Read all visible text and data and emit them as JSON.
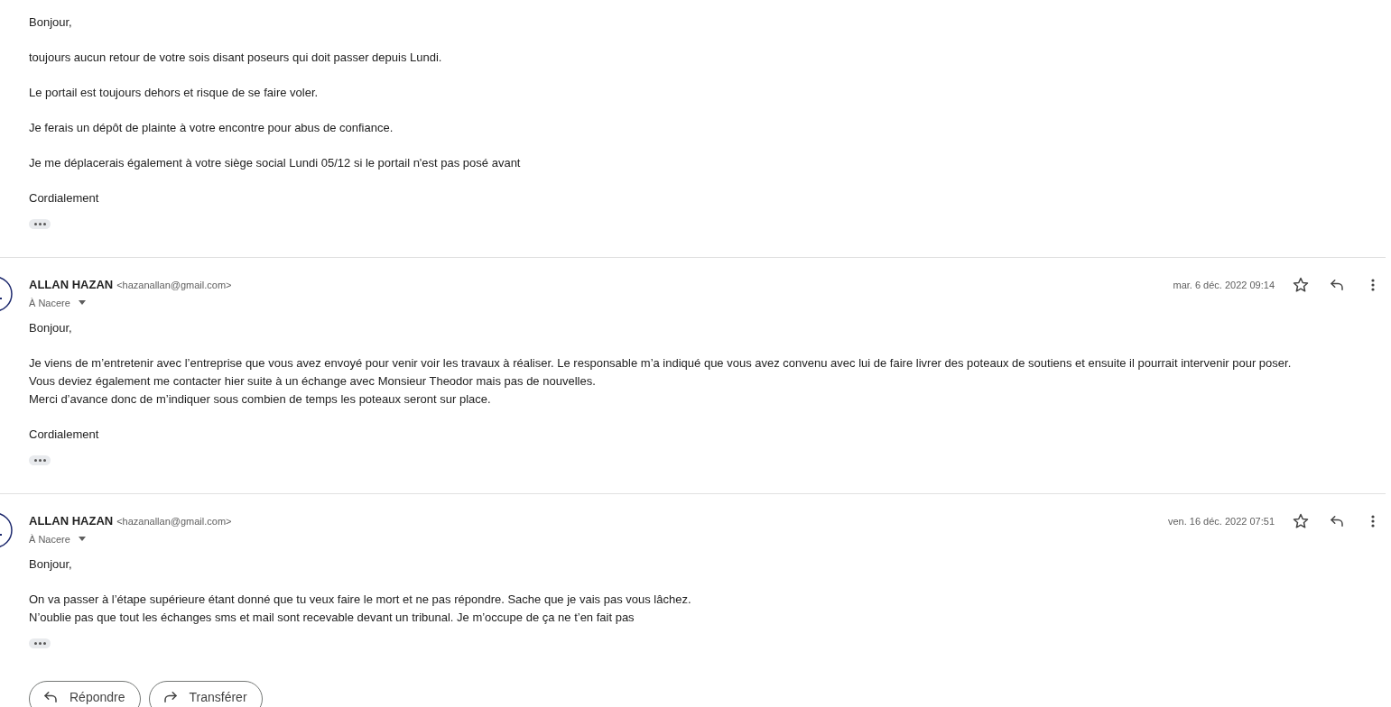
{
  "messages": [
    {
      "paragraphs": [
        [
          "Bonjour,"
        ],
        [
          "toujours aucun retour de votre sois disant poseurs qui doit passer depuis Lundi."
        ],
        [
          "Le portail est toujours dehors et risque de se faire voler."
        ],
        [
          "Je ferais un dépôt de plainte à votre encontre pour abus de confiance."
        ],
        [
          "Je me déplacerais également à votre siège social Lundi 05/12 si le portail n'est pas posé avant"
        ],
        [
          "Cordialement"
        ]
      ]
    },
    {
      "sender": "ALLAN HAZAN",
      "email": "<hazanallan@gmail.com>",
      "to": "À Nacere",
      "date": "mar. 6 déc. 2022 09:14",
      "starred": false,
      "paragraphs": [
        [
          "Bonjour,"
        ],
        [
          "Je viens de m’entretenir avec l’entreprise que vous avez envoyé pour venir voir les travaux à réaliser. Le responsable m’a indiqué que vous avez convenu avec lui de faire livrer des poteaux de soutiens et ensuite il pourrait intervenir pour poser.",
          "Vous deviez également me contacter hier suite à un échange avec Monsieur Theodor mais pas de nouvelles.",
          "Merci d’avance donc de m’indiquer sous combien de temps les poteaux seront sur place."
        ],
        [
          "Cordialement"
        ]
      ]
    },
    {
      "sender": "ALLAN HAZAN",
      "email": "<hazanallan@gmail.com>",
      "to": "À Nacere",
      "date": "ven. 16 déc. 2022 07:51",
      "starred": false,
      "paragraphs": [
        [
          "Bonjour,"
        ],
        [
          "On va passer à l’étape supérieure étant donné que tu veux faire le mort et ne pas répondre. Sache que je vais pas vous lâchez.",
          "N’oublie pas que tout les échanges sms et mail sont recevable devant un tribunal. Je m’occupe de ça ne t’en fait pas"
        ]
      ]
    }
  ],
  "actions": [
    {
      "label": "Répondre",
      "kind": "reply"
    },
    {
      "label": "Transférer",
      "kind": "forward"
    }
  ]
}
